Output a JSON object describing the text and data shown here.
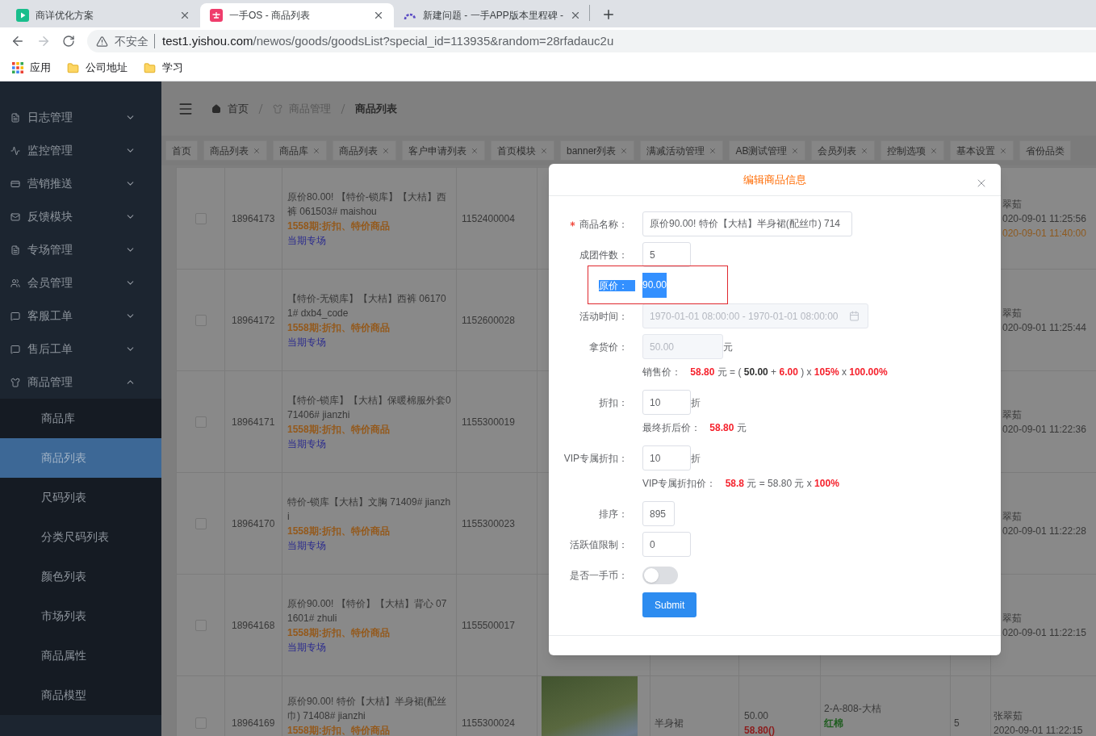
{
  "browser": {
    "tabs": [
      {
        "title": "商详优化方案",
        "selected": false
      },
      {
        "title": "一手OS - 商品列表",
        "selected": true
      },
      {
        "title": "新建问题 - 一手APP版本里程碑 -",
        "selected": false
      }
    ],
    "nav": {
      "forward_disabled": true
    },
    "address": {
      "security": "不安全",
      "domain": "test1.yishou.com",
      "path": "/newos/goods/goodsList?special_id=113935&random=28rfadauc2u"
    },
    "bookmarks": [
      {
        "label": "应用",
        "kind": "apps"
      },
      {
        "label": "公司地址",
        "kind": "folder"
      },
      {
        "label": "学习",
        "kind": "folder"
      }
    ]
  },
  "sidebar": {
    "items": [
      {
        "label": "日志管理",
        "expanded": false
      },
      {
        "label": "监控管理",
        "expanded": false
      },
      {
        "label": "营销推送",
        "expanded": false
      },
      {
        "label": "反馈模块",
        "expanded": false
      },
      {
        "label": "专场管理",
        "expanded": false
      },
      {
        "label": "会员管理",
        "expanded": false
      },
      {
        "label": "客服工单",
        "expanded": false
      },
      {
        "label": "售后工单",
        "expanded": false
      },
      {
        "label": "商品管理",
        "expanded": true,
        "children": [
          {
            "label": "商品库",
            "selected": false
          },
          {
            "label": "商品列表",
            "selected": true
          },
          {
            "label": "尺码列表",
            "selected": false
          },
          {
            "label": "分类尺码列表",
            "selected": false
          },
          {
            "label": "颜色列表",
            "selected": false
          },
          {
            "label": "市场列表",
            "selected": false
          },
          {
            "label": "商品属性",
            "selected": false
          },
          {
            "label": "商品模型",
            "selected": false
          }
        ]
      }
    ]
  },
  "breadcrumb": [
    {
      "label": "首页",
      "kind": "home"
    },
    {
      "label": "商品管理",
      "kind": "section"
    },
    {
      "label": "商品列表",
      "kind": "current"
    }
  ],
  "tags": [
    {
      "label": "首页",
      "closable": false
    },
    {
      "label": "商品列表",
      "closable": true
    },
    {
      "label": "商品库",
      "closable": true
    },
    {
      "label": "商品列表",
      "closable": true
    },
    {
      "label": "客户申请列表",
      "closable": true
    },
    {
      "label": "首页模块",
      "closable": true
    },
    {
      "label": "banner列表",
      "closable": true
    },
    {
      "label": "满减活动管理",
      "closable": true
    },
    {
      "label": "AB测试管理",
      "closable": true
    },
    {
      "label": "会员列表",
      "closable": true
    },
    {
      "label": "控制选项",
      "closable": true
    },
    {
      "label": "基本设置",
      "closable": true
    },
    {
      "label": "省份品类",
      "closable": false
    }
  ],
  "table": {
    "rows": [
      {
        "kind": "covered",
        "checked": false,
        "id": "18964173",
        "name": "原价80.00! 【特价-锁库】【大桔】西裤 061503# maishou",
        "promo": "1558期:折扣、特价商品",
        "link": "当期专场",
        "code": "1152400004",
        "creator": "翠茹",
        "times": [
          {
            "text": "020-09-01 11:25:56",
            "kind": "created"
          },
          {
            "text": "020-09-01 11:40:00",
            "kind": "updated"
          }
        ]
      },
      {
        "kind": "covered",
        "checked": false,
        "id": "18964172",
        "name": "【特价-无锁库】【大桔】西裤 061701# dxb4_code",
        "promo": "1558期:折扣、特价商品",
        "link": "当期专场",
        "code": "1152600028",
        "creator": "翠茹",
        "times": [
          {
            "text": "020-09-01 11:25:44",
            "kind": "created"
          }
        ]
      },
      {
        "kind": "covered",
        "checked": false,
        "id": "18964171",
        "name": "【特价-锁库】【大桔】保暖棉服外套071406# jianzhi",
        "promo": "1558期:折扣、特价商品",
        "link": "当期专场",
        "code": "1155300019",
        "creator": "翠茹",
        "times": [
          {
            "text": "020-09-01 11:22:36",
            "kind": "created"
          }
        ]
      },
      {
        "kind": "covered",
        "checked": false,
        "id": "18964170",
        "name": "特价-锁库【大桔】文胸 71409# jianzhi",
        "promo": "1558期:折扣、特价商品",
        "link": "当期专场",
        "code": "1155300023",
        "creator": "翠茹",
        "times": [
          {
            "text": "020-09-01 11:22:28",
            "kind": "created"
          }
        ]
      },
      {
        "kind": "covered",
        "checked": false,
        "id": "18964168",
        "name": "原价90.00! 【特价】【大桔】背心 071601# zhuli",
        "promo": "1558期:折扣、特价商品",
        "link": "当期专场",
        "code": "1155500017",
        "creator": "翠茹",
        "times": [
          {
            "text": "020-09-01 11:22:15",
            "kind": "created"
          }
        ]
      },
      {
        "kind": "full",
        "checked": false,
        "id": "18964169",
        "name": "原价90.00! 特价【大桔】半身裙(配丝巾) 71408# jianzhi",
        "promo": "1558期:折扣、特价商品",
        "code": "1155300024",
        "has_photo": true,
        "category": "半身裙",
        "cost": "50.00",
        "price": "58.80()",
        "location": "2-A-808-大桔",
        "fabric": "红棉",
        "count": "5",
        "creator": "张翠茹",
        "times": [
          {
            "text": "2020-09-01 11:22:15",
            "kind": "created"
          }
        ]
      }
    ]
  },
  "dialog": {
    "title": "编辑商品信息",
    "fields": [
      {
        "kind": "text",
        "label": "商品名称：",
        "required": true,
        "disabled": false,
        "value": "原价90.00! 特价【大桔】半身裙(配丝巾) 714"
      },
      {
        "kind": "text",
        "label": "成团件数：",
        "required": false,
        "disabled": false,
        "value": "5"
      },
      {
        "kind": "static",
        "label": "原价：",
        "required": false,
        "value": "90.00",
        "text_selected": true,
        "outlined": true
      },
      {
        "kind": "date-range",
        "label": "活动时间：",
        "required": false,
        "disabled": true,
        "value": "1970-01-01 08:00:00 - 1970-01-01 08:00:00"
      },
      {
        "kind": "text",
        "label": "拿货价：",
        "required": false,
        "disabled": true,
        "value": "50.00",
        "suffix": "元"
      },
      {
        "kind": "formula",
        "segments": [
          {
            "text": "销售价：",
            "kind": "label"
          },
          {
            "text": "58.80",
            "kind": "emphasis"
          },
          {
            "text": "元 = (",
            "kind": "plain"
          },
          {
            "text": "50.00",
            "kind": "strong"
          },
          {
            "text": "+",
            "kind": "plain"
          },
          {
            "text": "6.00",
            "kind": "emphasis"
          },
          {
            "text": ") x",
            "kind": "plain"
          },
          {
            "text": "105%",
            "kind": "emphasis"
          },
          {
            "text": "x",
            "kind": "plain"
          },
          {
            "text": "100.00%",
            "kind": "emphasis"
          }
        ]
      },
      {
        "kind": "text",
        "label": "折扣：",
        "required": false,
        "disabled": false,
        "value": "10",
        "suffix": "折"
      },
      {
        "kind": "formula",
        "segments": [
          {
            "text": "最终折后价：",
            "kind": "label"
          },
          {
            "text": "58.80",
            "kind": "emphasis"
          },
          {
            "text": "元",
            "kind": "plain"
          }
        ]
      },
      {
        "kind": "text",
        "label": "VIP专属折扣：",
        "required": false,
        "disabled": false,
        "value": "10",
        "suffix": "折"
      },
      {
        "kind": "formula",
        "segments": [
          {
            "text": "VIP专属折扣价：",
            "kind": "label"
          },
          {
            "text": "58.8",
            "kind": "emphasis"
          },
          {
            "text": "元 = 58.80 元 x",
            "kind": "plain"
          },
          {
            "text": "100%",
            "kind": "emphasis"
          }
        ]
      },
      {
        "kind": "text",
        "label": "排序：",
        "required": false,
        "disabled": false,
        "value": "895"
      },
      {
        "kind": "text",
        "label": "活跃值限制：",
        "required": false,
        "disabled": false,
        "value": "0"
      },
      {
        "kind": "switch",
        "label": "是否一手币：",
        "required": false,
        "on": false
      },
      {
        "kind": "button",
        "label": "Submit"
      }
    ]
  }
}
